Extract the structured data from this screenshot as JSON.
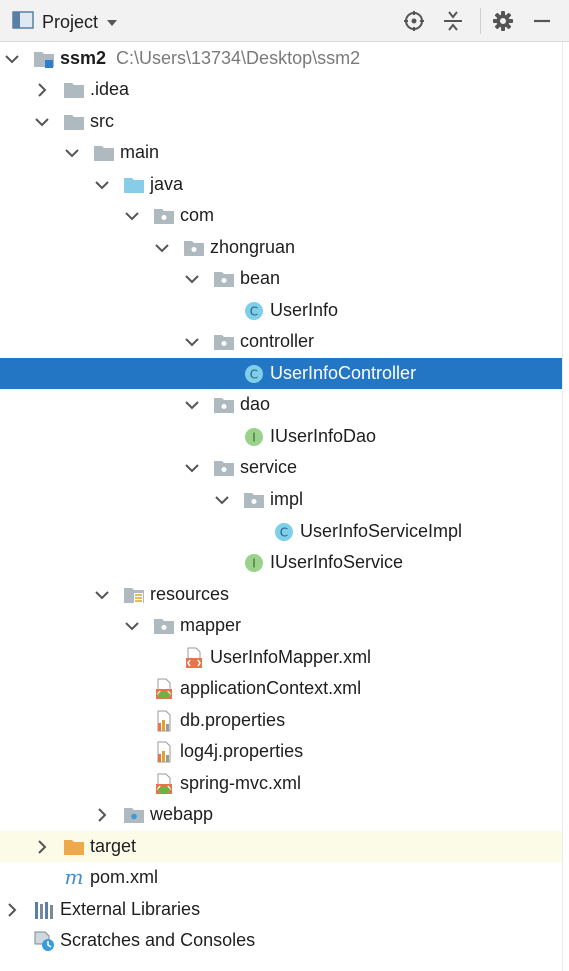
{
  "toolbar": {
    "title": "Project",
    "icons": [
      "project-view-icon",
      "dropdown-caret-icon",
      "locate-icon",
      "collapse-all-icon",
      "gear-icon",
      "minimize-icon"
    ]
  },
  "tree": {
    "root_name": "ssm2",
    "root_path": "C:\\Users\\13734\\Desktop\\ssm2",
    "idea": ".idea",
    "src": "src",
    "main": "main",
    "java": "java",
    "com": "com",
    "zhongruan": "zhongruan",
    "bean": "bean",
    "userinfo": "UserInfo",
    "controller": "controller",
    "userinfocontroller": "UserInfoController",
    "dao": "dao",
    "iuserinfodao": "IUserInfoDao",
    "service": "service",
    "impl": "impl",
    "userinfoserviceimpl": "UserInfoServiceImpl",
    "iuserinfoservice": "IUserInfoService",
    "resources": "resources",
    "mapper": "mapper",
    "userinfomapper": "UserInfoMapper.xml",
    "applicationcontext": "applicationContext.xml",
    "dbprops": "db.properties",
    "log4j": "log4j.properties",
    "springmvc": "spring-mvc.xml",
    "webapp": "webapp",
    "target": "target",
    "pom": "pom.xml",
    "extlibs": "External Libraries",
    "scratches": "Scratches and Consoles"
  },
  "colors": {
    "selection": "#2376c4",
    "folder_gray": "#aeb9c0",
    "source_folder": "#87cde8",
    "excluded_folder": "#f0a94a",
    "class_icon": "#7dcfea",
    "interface_icon": "#9ad28c"
  }
}
